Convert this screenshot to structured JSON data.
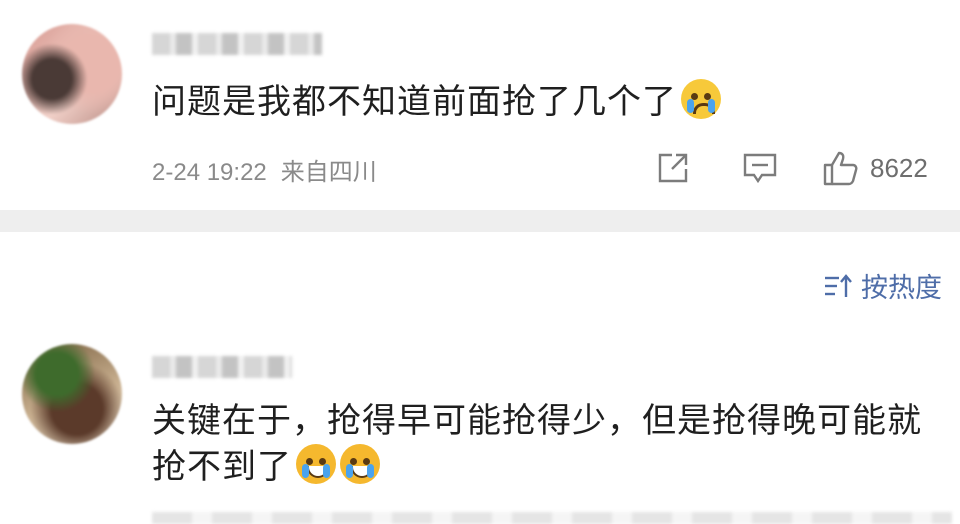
{
  "comments": [
    {
      "text": "问题是我都不知道前面抢了几个了",
      "emojis": [
        "crying-face-icon"
      ],
      "date": "2-24 19:22",
      "location": "来自四川",
      "likes": "8622"
    },
    {
      "text": "关键在于，抢得早可能抢得少，但是抢得晚可能就抢不到了",
      "emojis": [
        "laughing-crying-face-icon",
        "laughing-crying-face-icon"
      ]
    }
  ],
  "sort": {
    "label": "按热度",
    "icon": "sort-icon"
  },
  "colors": {
    "accent": "#4e6da8",
    "meta": "#8a8a8a",
    "divider": "#eeeeee"
  }
}
